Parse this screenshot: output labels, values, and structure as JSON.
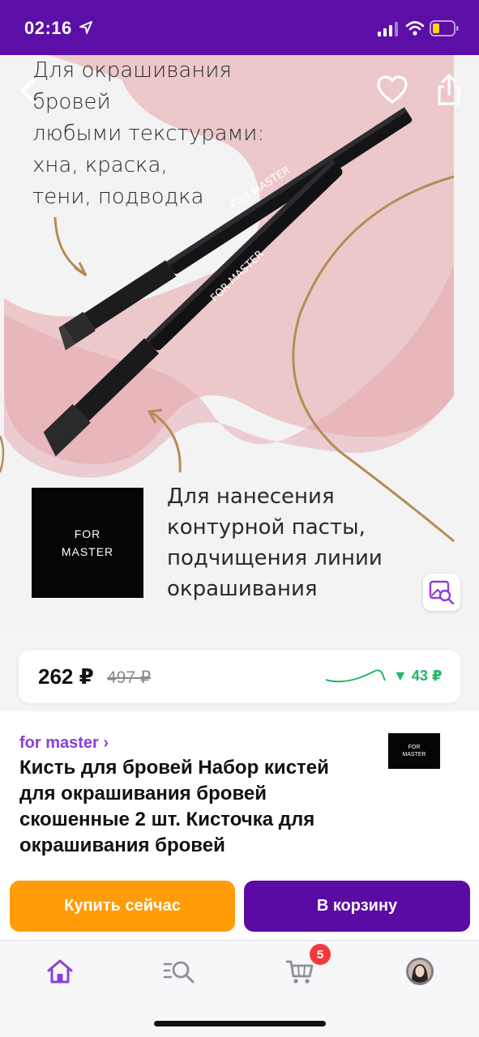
{
  "status_bar": {
    "time": "02:16",
    "icons": [
      "location-arrow-icon",
      "signal-icon",
      "wifi-icon",
      "battery-icon"
    ]
  },
  "hero": {
    "top_caption_lines": [
      "Для окрашивания",
      "бровей",
      "любыми текстурами:",
      "хна, краска,",
      "тени, подводка"
    ],
    "bottom_caption_lines": [
      "Для нанесения",
      "контурной пасты,",
      "подчищения линии",
      "окрашивания"
    ],
    "brand_box_lines": [
      "FOR",
      "MASTER"
    ],
    "brush_text": "FOR MASTER",
    "icons": {
      "back": "chevron-left-icon",
      "favorite": "heart-icon",
      "share": "share-icon",
      "visual_search": "image-search-icon"
    }
  },
  "price": {
    "current": "262 ₽",
    "old": "497 ₽",
    "drop": "▼ 43 ₽"
  },
  "product": {
    "brand_link": "for master ›",
    "title": "Кисть для бровей Набор кистей для окрашивания бровей скошенные 2 шт. Кисточка для окрашивания бровей",
    "thumb_lines": [
      "FOR",
      "MASTER"
    ]
  },
  "actions": {
    "buy_now": "Купить сейчас",
    "add_to_cart": "В корзину"
  },
  "tab_bar": {
    "cart_badge": "5",
    "icons": [
      "home-icon",
      "catalog-search-icon",
      "cart-icon",
      "profile-avatar"
    ]
  },
  "colors": {
    "brand_purple": "#5b0fa6",
    "buy_orange": "#ff9c07",
    "drop_green": "#1fb865",
    "badge_red": "#f4393c"
  }
}
